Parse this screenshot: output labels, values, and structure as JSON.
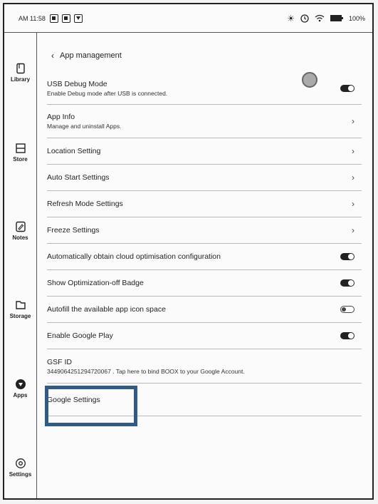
{
  "status_bar": {
    "time": "AM 11:58",
    "battery": "100%",
    "icons": [
      "brightness-icon",
      "sync-icon",
      "wifi-icon",
      "battery-icon"
    ]
  },
  "sidebar": {
    "items": [
      {
        "label": "Library",
        "icon": "book-icon"
      },
      {
        "label": "Store",
        "icon": "store-icon"
      },
      {
        "label": "Notes",
        "icon": "notes-icon"
      },
      {
        "label": "Storage",
        "icon": "folder-icon"
      },
      {
        "label": "Apps",
        "icon": "apps-icon",
        "active": true
      },
      {
        "label": "Settings",
        "icon": "settings-icon"
      }
    ]
  },
  "header": {
    "back_label": "App management"
  },
  "settings": {
    "usb_debug": {
      "title": "USB Debug Mode",
      "subtitle": "Enable Debug mode after USB is connected.",
      "on": true
    },
    "app_info": {
      "title": "App Info",
      "subtitle": "Manage and uninstall Apps."
    },
    "location": {
      "title": "Location Setting"
    },
    "auto_start": {
      "title": "Auto Start Settings"
    },
    "refresh_mode": {
      "title": "Refresh Mode Settings"
    },
    "freeze": {
      "title": "Freeze Settings"
    },
    "cloud_opt": {
      "title": "Automatically obtain cloud optimisation configuration",
      "on": true
    },
    "opt_badge": {
      "title": "Show Optimization-off Badge",
      "on": true
    },
    "autofill": {
      "title": "Autofill the available app icon space",
      "on": false
    },
    "google_play": {
      "title": "Enable Google Play",
      "on": true
    },
    "gsf": {
      "title": "GSF ID",
      "subtitle": "3449064251294720067 . Tap here to bind BOOX to your Google Account."
    },
    "google_settings": {
      "title": "Google Settings"
    }
  },
  "colors": {
    "highlight": "#2f5a8e"
  }
}
